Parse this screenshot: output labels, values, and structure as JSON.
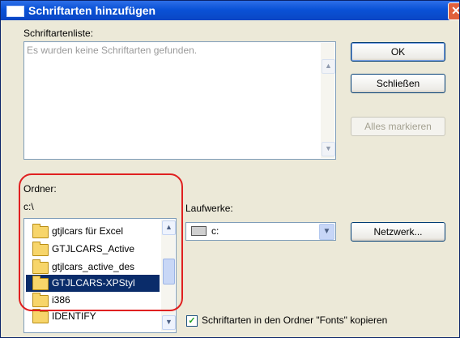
{
  "dialog": {
    "title": "Schriftarten hinzufügen",
    "close_glyph": "✕"
  },
  "fontlist": {
    "label": "Schriftartenliste:",
    "empty_text": "Es wurden keine Schriftarten gefunden."
  },
  "buttons": {
    "ok": "OK",
    "close": "Schließen",
    "select_all": "Alles markieren",
    "network": "Netzwerk..."
  },
  "folder": {
    "label": "Ordner:",
    "path": "c:\\",
    "items": [
      {
        "name": "gtjlcars für Excel",
        "selected": false
      },
      {
        "name": "GTJLCARS_Active",
        "selected": false
      },
      {
        "name": "gtjlcars_active_des",
        "selected": false
      },
      {
        "name": "GTJLCARS-XPStyl",
        "selected": true
      },
      {
        "name": "i386",
        "selected": false
      },
      {
        "name": "IDENTIFY",
        "selected": false
      }
    ]
  },
  "drives": {
    "label": "Laufwerke:",
    "selected": "c:"
  },
  "copy_option": {
    "label": "Schriftarten in den Ordner \"Fonts\" kopieren",
    "checked": true
  },
  "icons": {
    "scroll_up": "up-arrow-icon",
    "scroll_down": "down-arrow-icon",
    "folder": "folder-icon",
    "drive": "drive-icon",
    "check": "checkmark-icon"
  },
  "colors": {
    "title_bar": "#0a52d6",
    "selection": "#0a2c6a",
    "annotation_ring": "#e02020"
  }
}
